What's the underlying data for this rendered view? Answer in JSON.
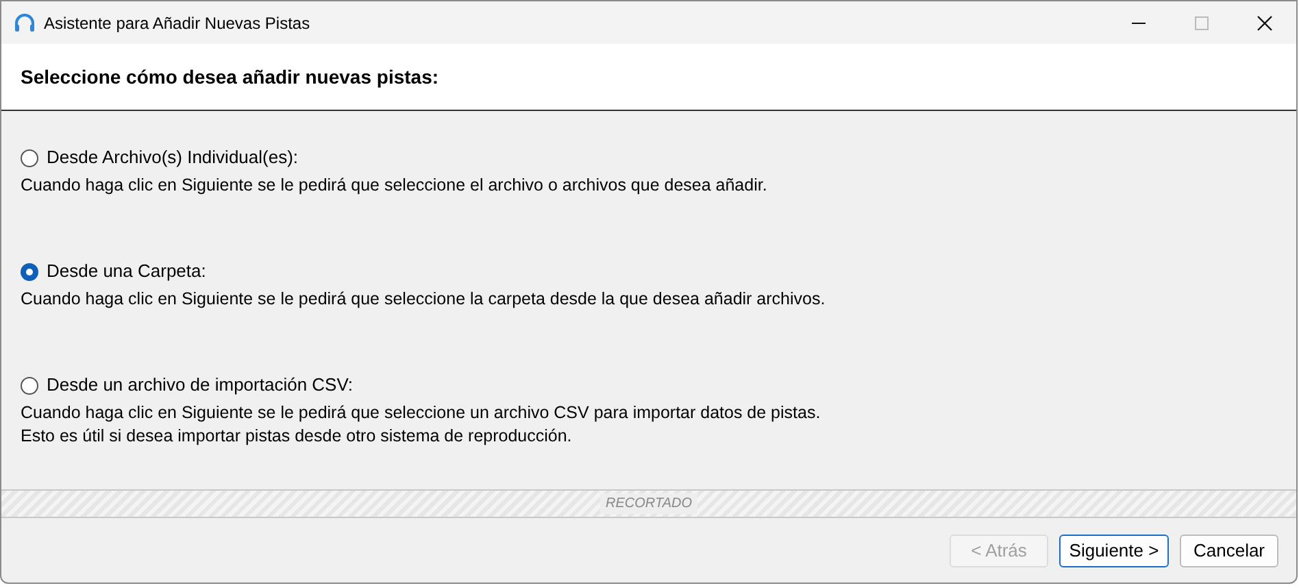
{
  "window": {
    "title": "Asistente para Añadir Nuevas Pistas"
  },
  "header": {
    "title": "Seleccione cómo desea añadir nuevas pistas:"
  },
  "options": [
    {
      "label": "Desde Archivo(s) Individual(es):",
      "selected": false,
      "description": [
        "Cuando haga clic en Siguiente se le pedirá que seleccione el archivo o archivos que desea añadir."
      ]
    },
    {
      "label": "Desde una Carpeta:",
      "selected": true,
      "description": [
        "Cuando haga clic en Siguiente se le pedirá que seleccione la carpeta desde la que desea añadir archivos."
      ]
    },
    {
      "label": "Desde un archivo de importación CSV:",
      "selected": false,
      "description": [
        "Cuando haga clic en Siguiente se le pedirá que seleccione un archivo CSV para importar datos de pistas.",
        "Esto es útil si desea importar pistas desde otro sistema de reproducción."
      ]
    }
  ],
  "cropped_band": {
    "label": "RECORTADO"
  },
  "buttons": [
    {
      "label": "< Atrás",
      "disabled": true,
      "default": false
    },
    {
      "label": "Siguiente >",
      "disabled": false,
      "default": true
    },
    {
      "label": "Cancelar",
      "disabled": false,
      "default": false
    }
  ]
}
